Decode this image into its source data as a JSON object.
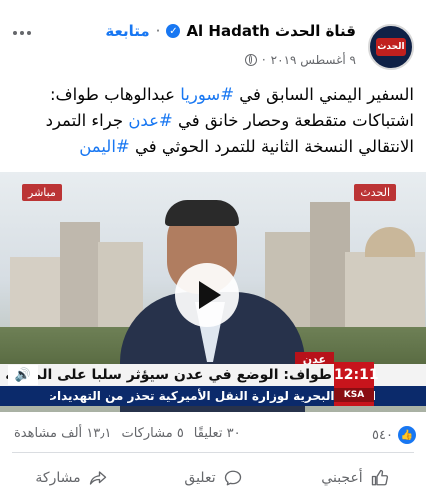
{
  "post": {
    "page_name": "قناة الحدث Al Hadath",
    "separator": "·",
    "follow_label": "متابعة",
    "date": "٩ أغسطس ٢٠١٩",
    "avatar_text": "الحدث",
    "text_parts": [
      {
        "t": "السفير اليمني السابق في ",
        "tag": false
      },
      {
        "t": "#سوريا",
        "tag": true
      },
      {
        "t": " عبدالوهاب طواف: اشتباكات متقطعة وحصار خانق في ",
        "tag": false
      },
      {
        "t": "#عدن",
        "tag": true
      },
      {
        "t": " جراء التمرد الانتقالي النسخة الثانية للتمرد الحوثي في ",
        "tag": false
      },
      {
        "t": "#اليمن",
        "tag": true
      }
    ]
  },
  "video": {
    "location_tag": "عدن",
    "headline": "طواف: الوضع في عدن سيؤثر سلبا على المدينة وسائر البلا",
    "ticker": "الإدارة البحرية لوزارة النقل الأميركية تحذر من التهديدات الإيرانية في مضيق هرمز",
    "clock_time": "12:11",
    "clock_city": "KSA",
    "channel_left": "مباشر",
    "channel_right": "الحدث"
  },
  "stats": {
    "reactions_count": "٥٤٠",
    "comments": "٣٠ تعليقًا",
    "shares": "٥ مشاركات",
    "views": "١٣٫١ ألف مشاهدة"
  },
  "actions": {
    "like": "أعجبني",
    "comment": "تعليق",
    "share": "مشاركة"
  },
  "colors": {
    "link_blue": "#1877f2",
    "secondary_text": "#65676b",
    "ticker_blue": "#0b2a6b",
    "alert_red": "#c8141c"
  }
}
